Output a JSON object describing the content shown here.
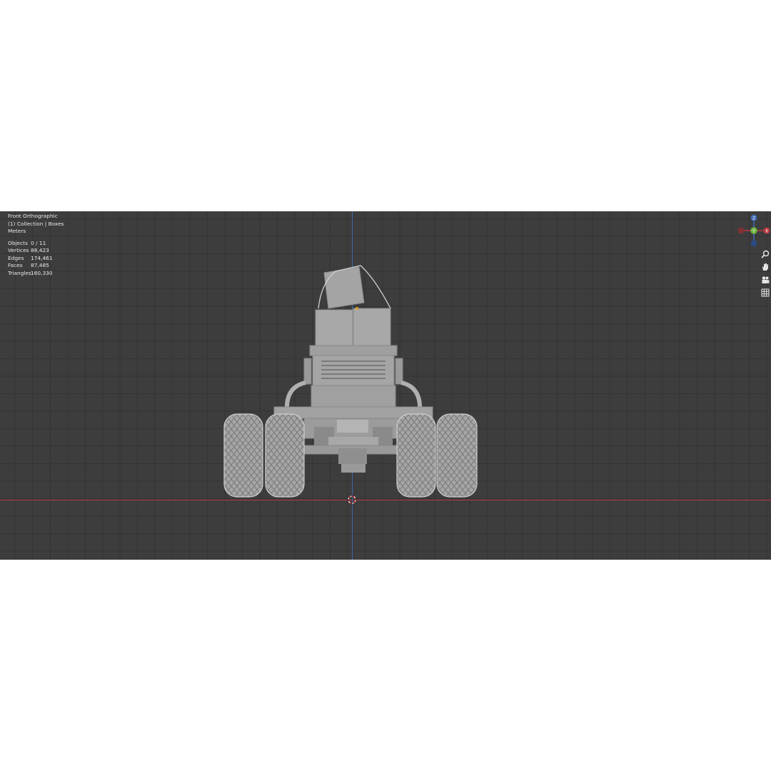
{
  "viewport": {
    "view_name": "Front Orthographic",
    "collection_info": "(1) Collection | Boxes",
    "units": "Meters",
    "stats": [
      {
        "label": "Objects",
        "value": "0 / 11"
      },
      {
        "label": "Vertices",
        "value": "88,423"
      },
      {
        "label": "Edges",
        "value": "174,461"
      },
      {
        "label": "Faces",
        "value": "87,485"
      },
      {
        "label": "Triangles",
        "value": "160,330"
      }
    ]
  },
  "gizmo": {
    "z_label": "Z",
    "y_label": "Y",
    "x_label": "X"
  },
  "navigation": [
    {
      "name": "zoom-icon"
    },
    {
      "name": "pan-hand-icon"
    },
    {
      "name": "camera-icon"
    },
    {
      "name": "grid-perspective-icon"
    }
  ],
  "colors": {
    "background": "#3d3d3d",
    "x_axis": "#b83a3f",
    "y_axis": "#6eb43f",
    "z_axis": "#3f68b0",
    "model": "#a9a9a9"
  }
}
